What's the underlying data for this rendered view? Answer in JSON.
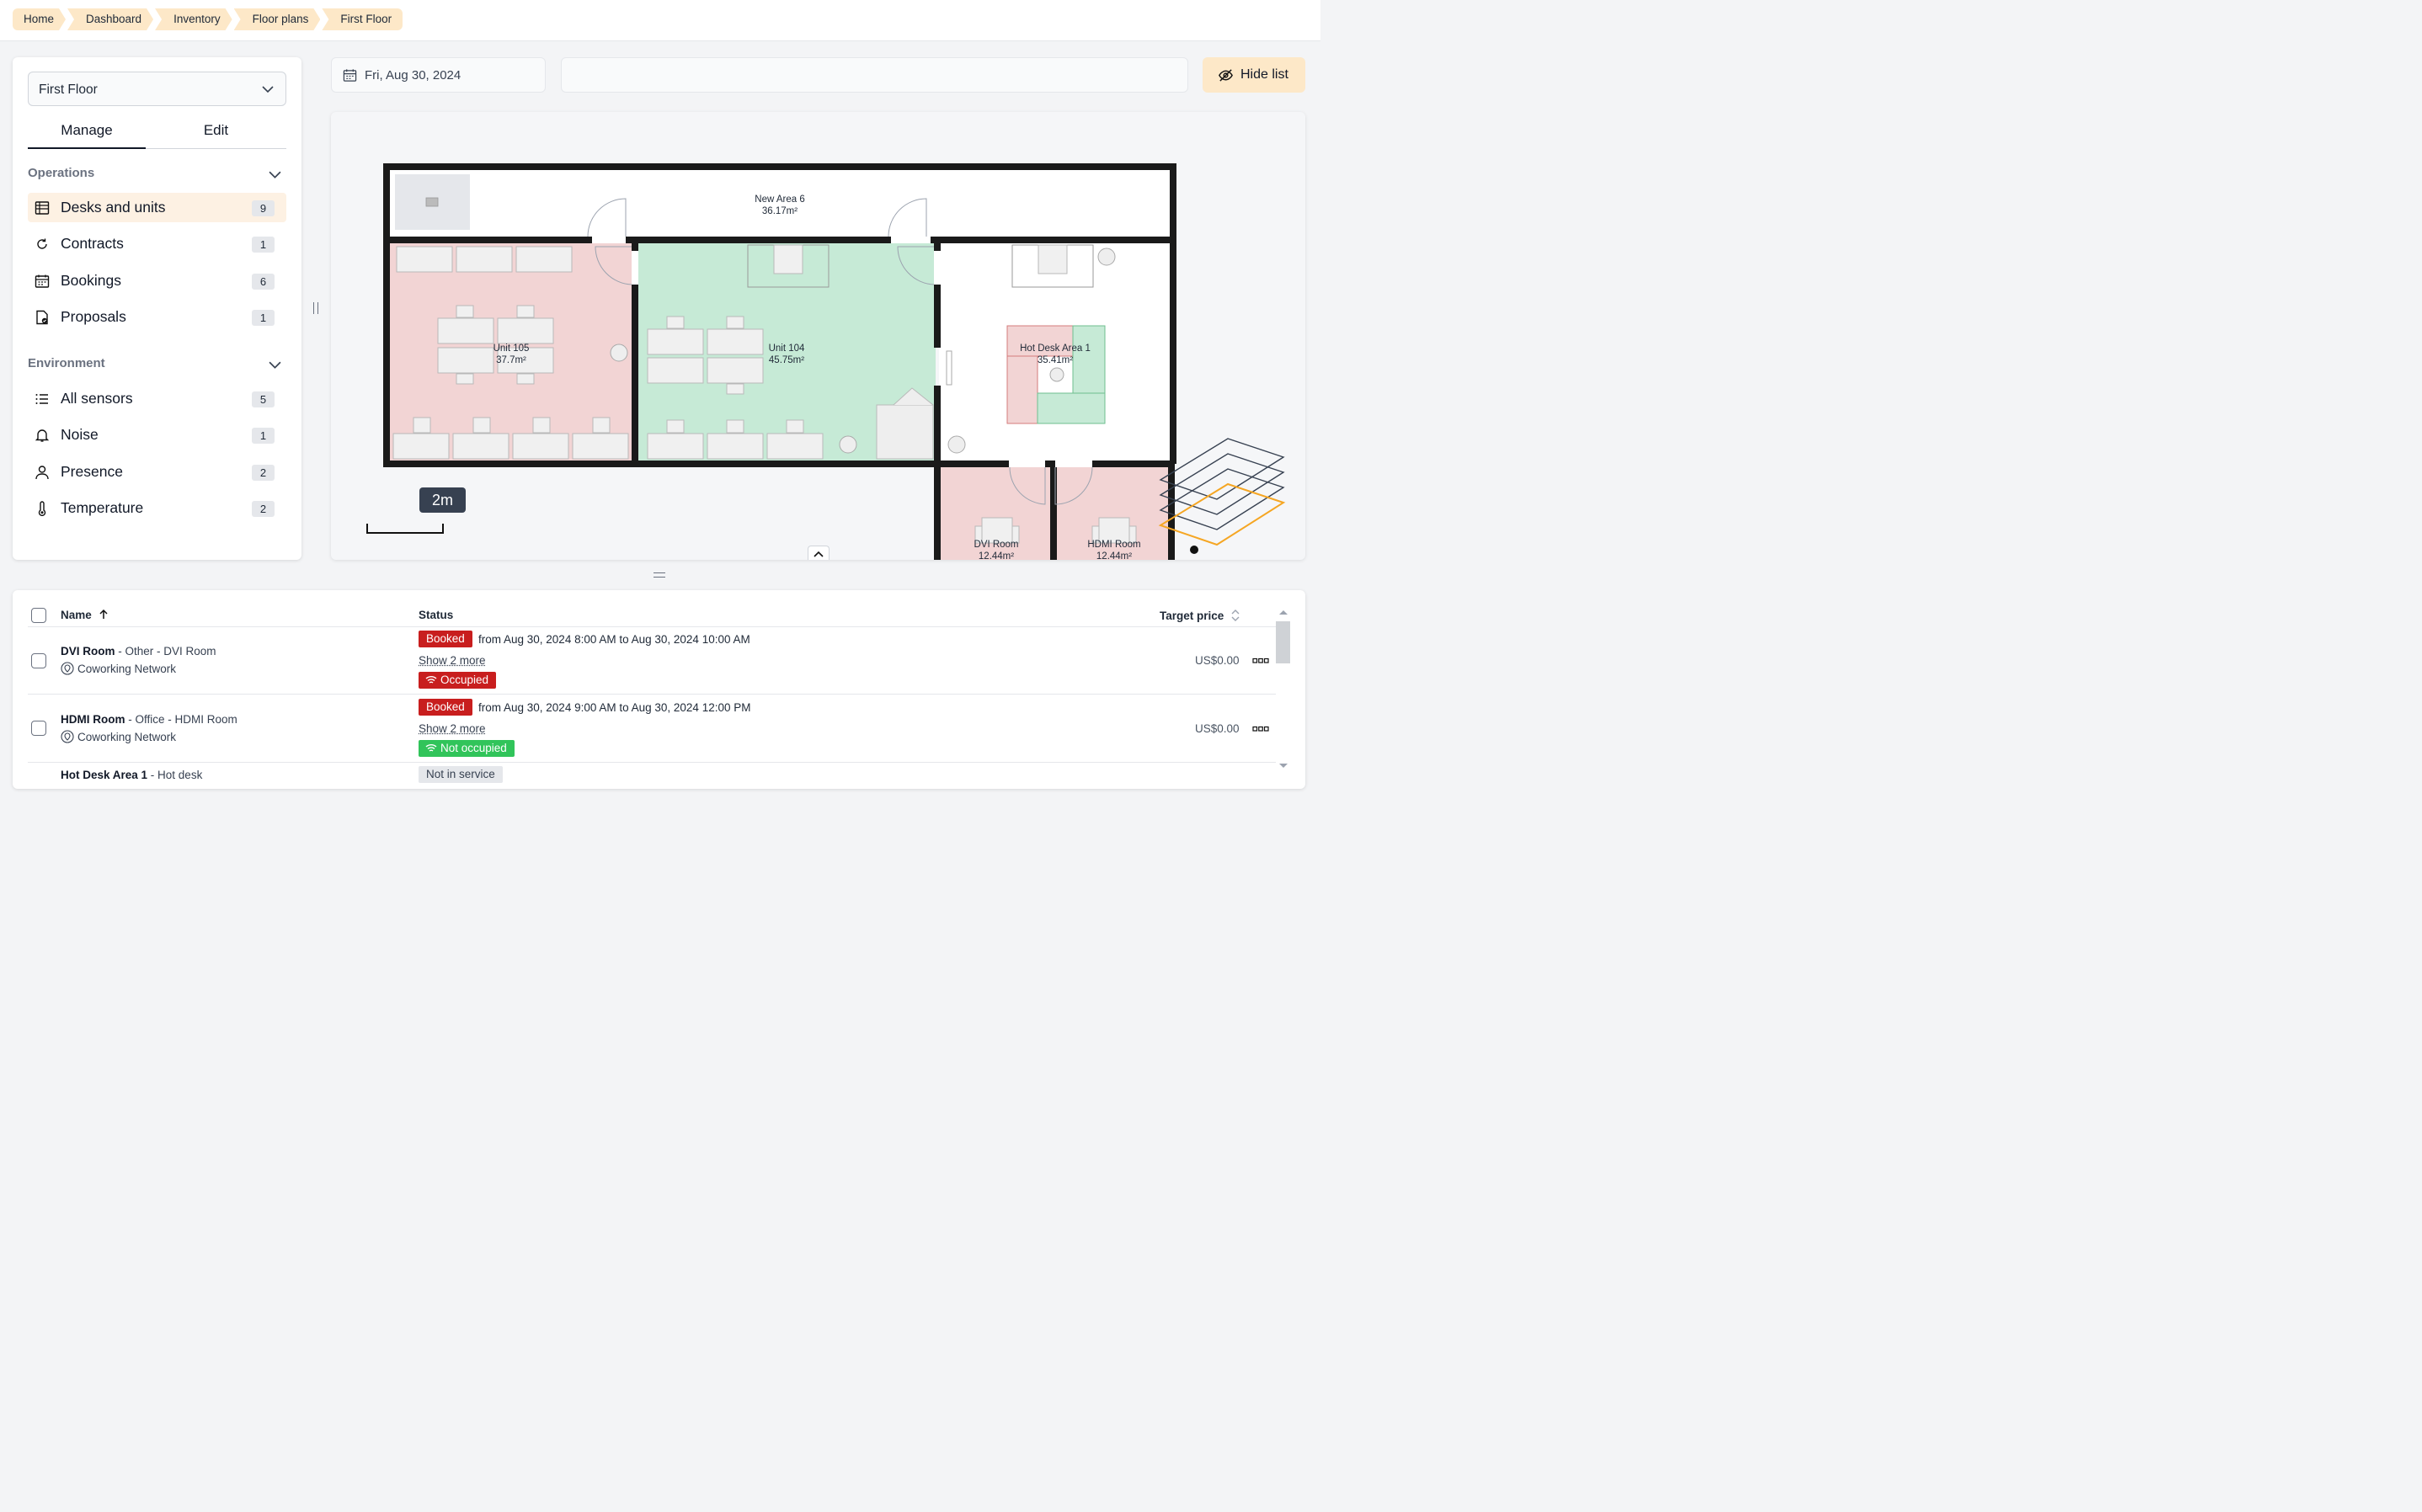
{
  "breadcrumbs": [
    "Home",
    "Dashboard",
    "Inventory",
    "Floor plans",
    "First Floor"
  ],
  "sidebar": {
    "floor_select": "First Floor",
    "tabs": [
      "Manage",
      "Edit"
    ],
    "operations_title": "Operations",
    "operations": [
      {
        "label": "Desks and units",
        "count": "9",
        "icon": "table-icon"
      },
      {
        "label": "Contracts",
        "count": "1",
        "icon": "refresh-icon"
      },
      {
        "label": "Bookings",
        "count": "6",
        "icon": "calendar-icon"
      },
      {
        "label": "Proposals",
        "count": "1",
        "icon": "document-check-icon"
      }
    ],
    "environment_title": "Environment",
    "environment": [
      {
        "label": "All sensors",
        "count": "5",
        "icon": "list-icon"
      },
      {
        "label": "Noise",
        "count": "1",
        "icon": "bell-icon"
      },
      {
        "label": "Presence",
        "count": "2",
        "icon": "person-icon"
      },
      {
        "label": "Temperature",
        "count": "2",
        "icon": "thermometer-icon"
      }
    ]
  },
  "toolbar": {
    "date": "Fri, Aug 30, 2024",
    "search_value": "",
    "hide_list_label": "Hide list"
  },
  "map": {
    "scale_label": "2m",
    "rooms": [
      {
        "name": "New Area 6",
        "area": "36.17m²",
        "status": "none"
      },
      {
        "name": "Unit 105",
        "area": "37.7m²",
        "status": "occupied"
      },
      {
        "name": "Unit 104",
        "area": "45.75m²",
        "status": "available"
      },
      {
        "name": "Hot Desk Area 1",
        "area": "35.41m²",
        "status": "none"
      },
      {
        "name": "DVI Room",
        "area": "12.44m²",
        "status": "occupied"
      },
      {
        "name": "HDMI Room",
        "area": "12.44m²",
        "status": "occupied"
      }
    ],
    "colors": {
      "occupied": "#f2d4d4",
      "available": "#c6ead6",
      "wall": "#1a1a1a",
      "floor_selected": "#f5a623"
    }
  },
  "table": {
    "headers": {
      "name": "Name",
      "status": "Status",
      "price": "Target price"
    },
    "rows": [
      {
        "name": "DVI Room",
        "meta": " - Other - DVI Room",
        "location": "Coworking Network",
        "booking_badge": "Booked",
        "booking_range": "from Aug 30, 2024 8:00 AM to Aug 30, 2024 10:00 AM",
        "show_more": "Show 2 more",
        "occupancy": "Occupied",
        "price": "US$0.00"
      },
      {
        "name": "HDMI Room",
        "meta": " - Office - HDMI Room",
        "location": "Coworking Network",
        "booking_badge": "Booked",
        "booking_range": "from Aug 30, 2024 9:00 AM to Aug 30, 2024 12:00 PM",
        "show_more": "Show 2 more",
        "occupancy": "Not occupied",
        "price": "US$0.00"
      },
      {
        "name": "Hot Desk Area 1",
        "meta": " - Hot desk",
        "status_badge": "Not in service"
      }
    ]
  }
}
